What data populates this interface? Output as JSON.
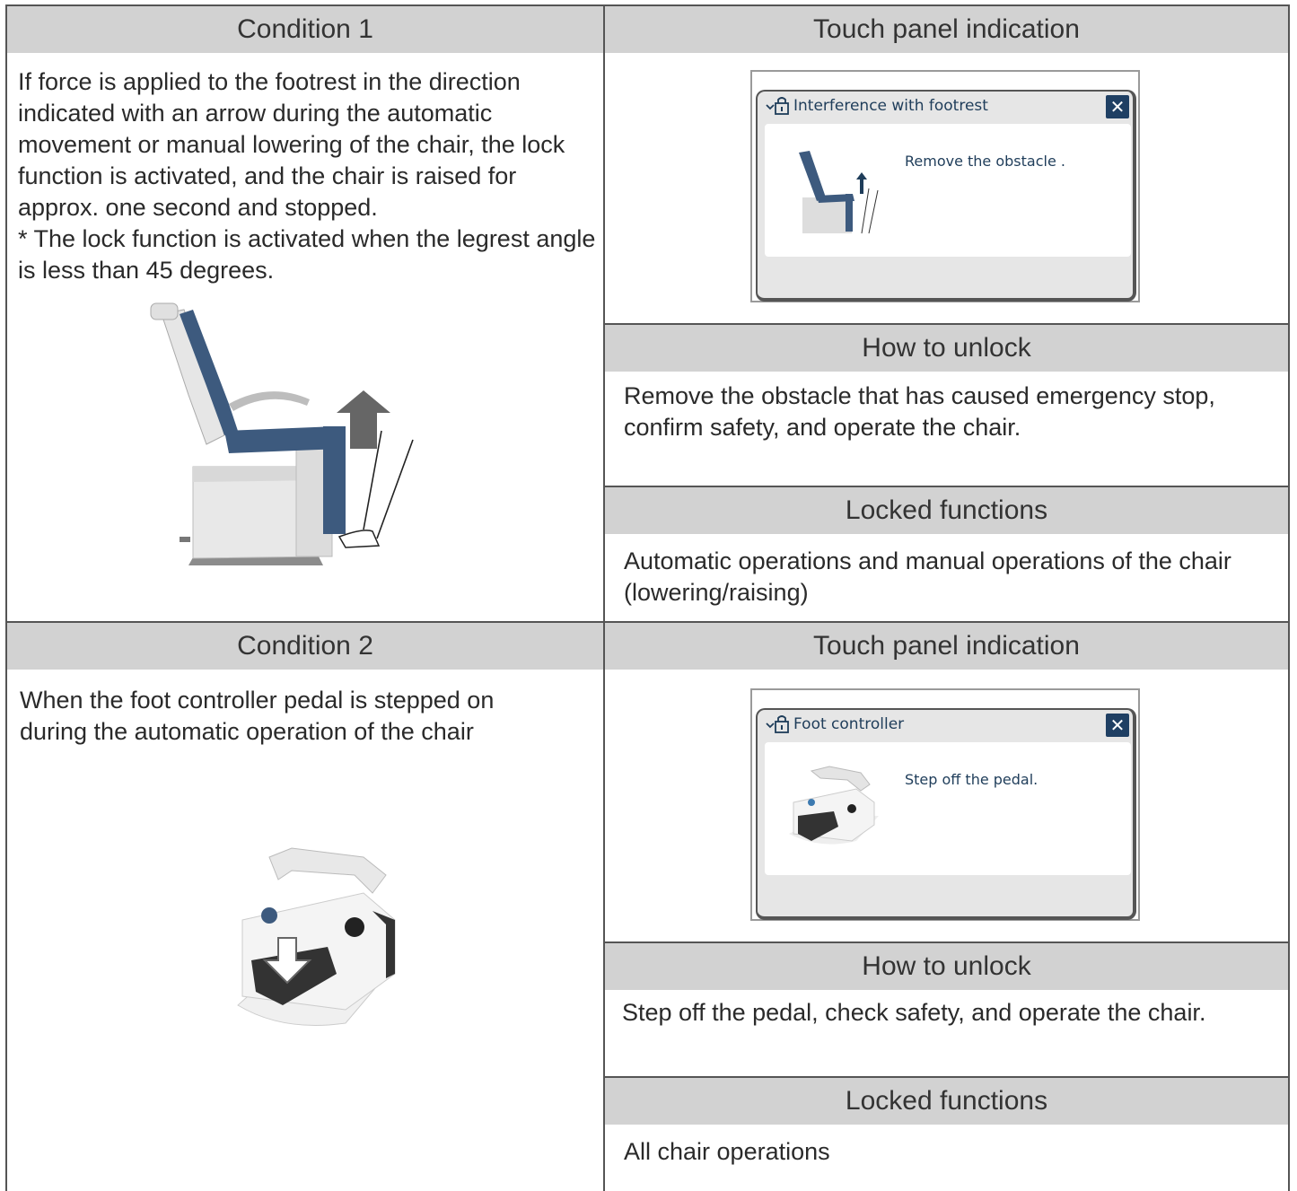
{
  "condition1": {
    "header": "Condition 1",
    "description": "If force is applied to the footrest in the direction indicated with an arrow during the automatic movement or manual lowering of the chair, the lock function is activated, and the chair is raised for approx. one second and stopped.",
    "note": "* The lock function is activated when the legrest angle is less than 45 degrees.",
    "touch_panel_header": "Touch panel indication",
    "dialog": {
      "title": "Interference with footrest",
      "message": "Remove the obstacle .",
      "close_glyph": "✕"
    },
    "unlock_header": "How to unlock",
    "unlock_text": "Remove the obstacle that has caused emergency stop, confirm safety, and operate the chair.",
    "locked_header": "Locked functions",
    "locked_text": "Automatic operations and manual operations of the chair (lowering/raising)"
  },
  "condition2": {
    "header": "Condition 2",
    "description": "When the foot controller pedal is stepped on during the automatic operation of the chair",
    "touch_panel_header": "Touch panel indication",
    "dialog": {
      "title": "Foot controller",
      "message": "Step off the pedal.",
      "close_glyph": "✕"
    },
    "unlock_header": "How to unlock",
    "unlock_text": "Step off the pedal, check safety, and operate the chair.",
    "locked_header": "Locked functions",
    "locked_text": "All chair operations"
  },
  "colors": {
    "header_bg": "#d2d2d2",
    "dialog_title": "#1f3d5a",
    "close_button": "#1f3f63",
    "chair_upholstery": "#3d5a7e",
    "arrow_gray": "#666666"
  }
}
